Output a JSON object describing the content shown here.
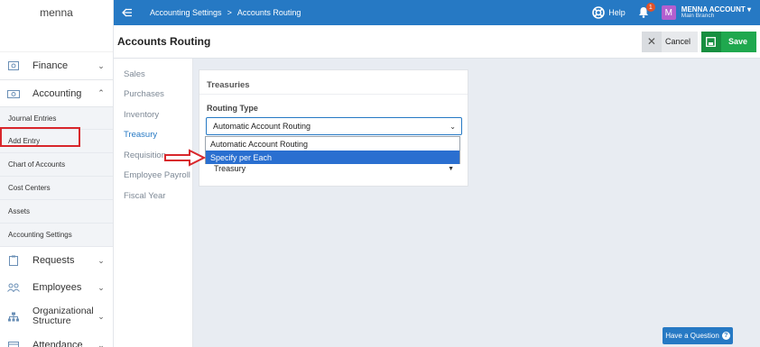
{
  "brand": "menna",
  "breadcrumb": {
    "parent": "Accounting Settings",
    "separator": ">",
    "current": "Accounts Routing"
  },
  "topbar": {
    "help_label": "Help",
    "notifications_count": "1",
    "avatar_initial": "M",
    "account_name": "MENNA ACCOUNT",
    "account_caret": "▾",
    "branch": "Main Branch"
  },
  "page": {
    "title": "Accounts Routing",
    "cancel_label": "Cancel",
    "save_label": "Save"
  },
  "sidebar": {
    "finance": "Finance",
    "accounting": "Accounting",
    "sub_items": [
      "Journal Entries",
      "Add Entry",
      "Chart of Accounts",
      "Cost Centers",
      "Assets",
      "Accounting Settings"
    ],
    "requests": "Requests",
    "employees": "Employees",
    "organizational_structure": "Organizational Structure",
    "attendance": "Attendance"
  },
  "tabs": [
    "Sales",
    "Purchases",
    "Inventory",
    "Treasury",
    "Requisition",
    "Employee Payroll",
    "Fiscal Year"
  ],
  "active_tab": "Treasury",
  "panel": {
    "heading": "Treasuries",
    "routing_type_label": "Routing Type",
    "routing_type_value": "Automatic Account Routing",
    "dropdown_options": [
      "Automatic Account Routing",
      "Specify per Each"
    ],
    "highlighted_option": "Specify per Each",
    "second_select_value": "Treasury"
  },
  "help_widget": {
    "label": "Have a Question",
    "icon": "?"
  },
  "colors": {
    "primary": "#2679c4",
    "save_green": "#1fa84e",
    "highlight_red": "#d8262b",
    "option_selected": "#2a6fd0"
  }
}
